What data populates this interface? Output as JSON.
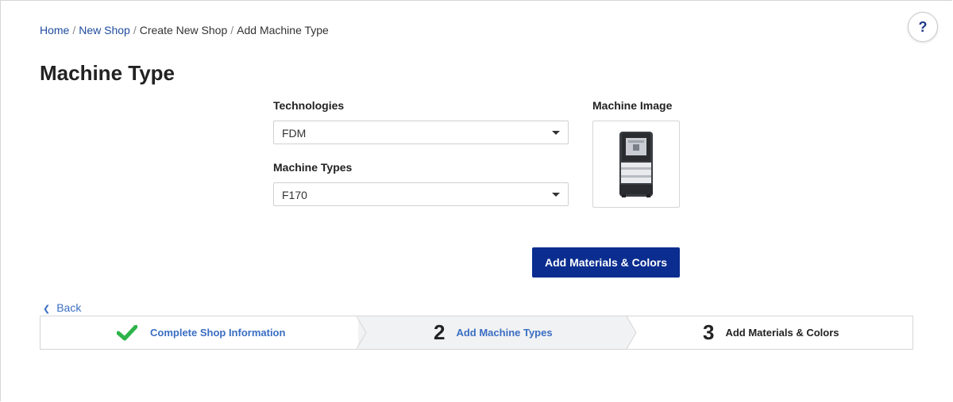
{
  "breadcrumb": {
    "items": [
      "Home",
      "New Shop",
      "Create New Shop",
      "Add Machine Type"
    ],
    "separator": "/"
  },
  "help": {
    "label": "?"
  },
  "page": {
    "title": "Machine Type"
  },
  "form": {
    "technologies": {
      "label": "Technologies",
      "value": "FDM"
    },
    "machine_types": {
      "label": "Machine Types",
      "value": "F170"
    },
    "machine_image": {
      "label": "Machine Image",
      "icon": "3d-printer-icon"
    },
    "submit_label": "Add Materials & Colors"
  },
  "back": {
    "label": "Back"
  },
  "steps": [
    {
      "number": "",
      "label": "Complete Shop Information",
      "state": "complete"
    },
    {
      "number": "2",
      "label": "Add Machine Types",
      "state": "active"
    },
    {
      "number": "3",
      "label": "Add Materials & Colors",
      "state": "pending"
    }
  ],
  "colors": {
    "primary": "#0a2d8f",
    "link": "#1f4b9e",
    "check": "#2db34a"
  }
}
